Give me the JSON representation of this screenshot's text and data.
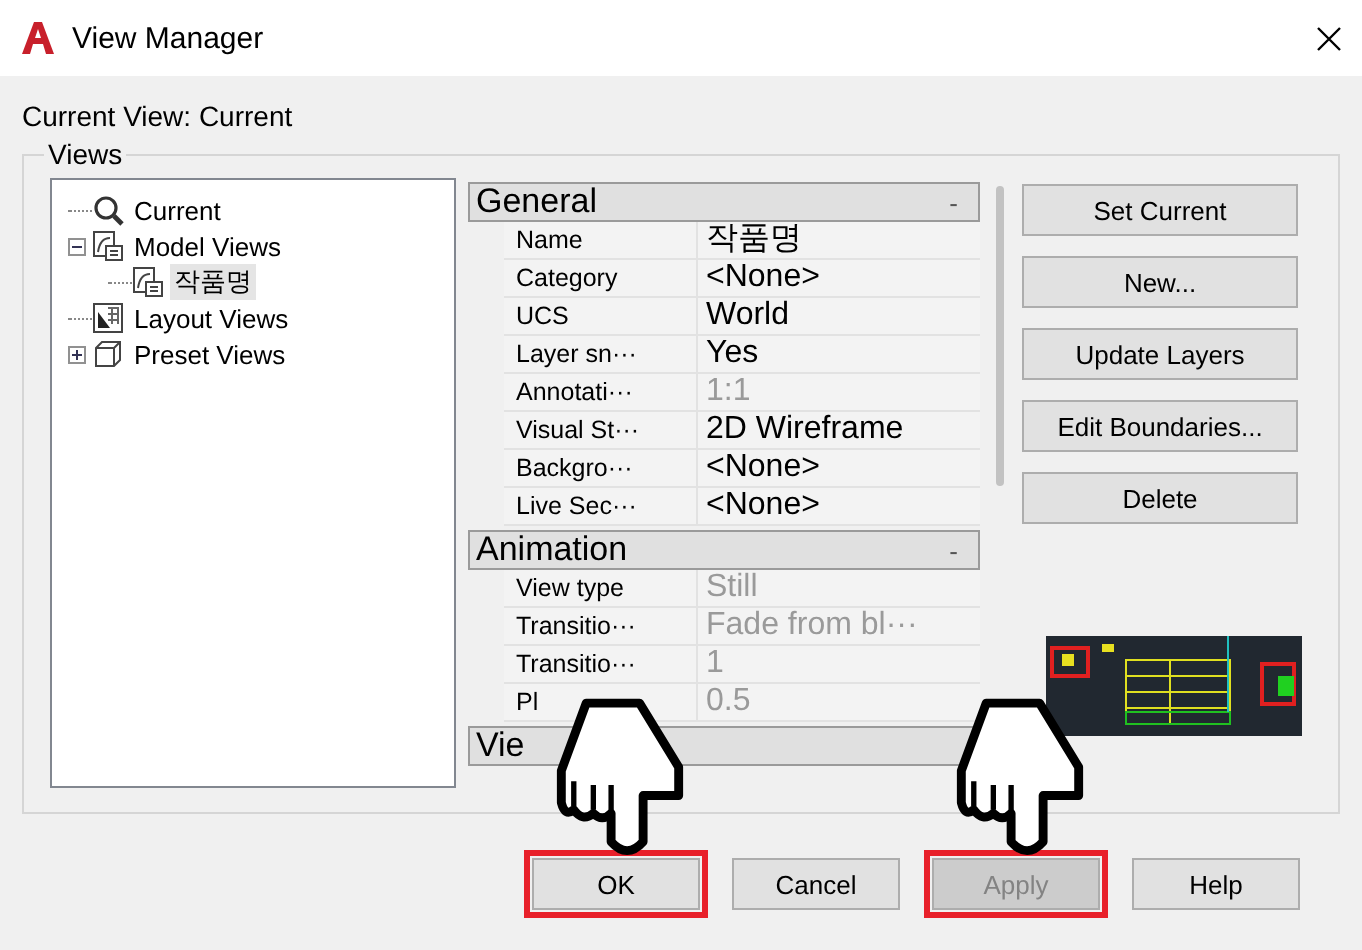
{
  "window": {
    "title": "View Manager"
  },
  "current_view": "Current View: Current",
  "views_group": {
    "label": "Views"
  },
  "tree": [
    {
      "label": "Current",
      "kind": "camera",
      "selected": false
    },
    {
      "label": "Model Views",
      "kind": "model",
      "selected": false,
      "expanded": true,
      "children": [
        {
          "label": "작품명",
          "kind": "model",
          "selected": true
        }
      ]
    },
    {
      "label": "Layout Views",
      "kind": "layout",
      "selected": false
    },
    {
      "label": "Preset Views",
      "kind": "preset",
      "selected": false,
      "expanded": false
    }
  ],
  "properties": [
    {
      "title": "General",
      "toggle": "-",
      "rows": [
        {
          "label": "Name",
          "value": "작품명",
          "disabled": false
        },
        {
          "label": "Category",
          "value": "<None>",
          "disabled": false
        },
        {
          "label": "UCS",
          "value": "World",
          "disabled": false
        },
        {
          "label": "Layer sn···",
          "value": "Yes",
          "disabled": false
        },
        {
          "label": "Annotati···",
          "value": "1:1",
          "disabled": true
        },
        {
          "label": "Visual St···",
          "value": "2D Wireframe",
          "disabled": false
        },
        {
          "label": "Backgro···",
          "value": "<None>",
          "disabled": false
        },
        {
          "label": "Live Sec···",
          "value": "<None>",
          "disabled": false
        }
      ]
    },
    {
      "title": "Animation",
      "toggle": "-",
      "rows": [
        {
          "label": "View type",
          "value": "Still",
          "disabled": true
        },
        {
          "label": "Transitio···",
          "value": "Fade from bl···",
          "disabled": true
        },
        {
          "label": "Transitio···",
          "value": "1",
          "disabled": true
        },
        {
          "label": "Pl",
          "value": "0.5",
          "disabled": true
        }
      ]
    },
    {
      "title": "Vie"
    }
  ],
  "side_buttons": [
    {
      "label": "Set Current"
    },
    {
      "label": "New..."
    },
    {
      "label": "Update Layers"
    },
    {
      "label": "Edit Boundaries..."
    },
    {
      "label": "Delete"
    }
  ],
  "footer_buttons": [
    {
      "label": "OK",
      "disabled": false,
      "highlighted": true,
      "pointed": true
    },
    {
      "label": "Cancel",
      "disabled": false,
      "highlighted": false,
      "pointed": false
    },
    {
      "label": "Apply",
      "disabled": true,
      "highlighted": true,
      "pointed": true
    },
    {
      "label": "Help",
      "disabled": false,
      "highlighted": false,
      "pointed": false
    }
  ]
}
